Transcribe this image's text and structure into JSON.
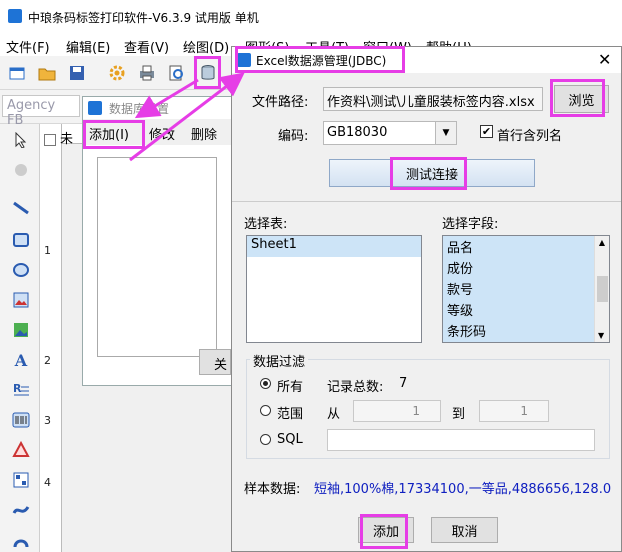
{
  "app": {
    "title": "中琅条码标签打印软件-V6.3.9 试用版 单机",
    "menu": [
      "文件(F)",
      "编辑(E)",
      "查看(V)",
      "绘图(D)",
      "图形(S)",
      "工具(T)",
      "窗口(W)",
      "帮助(H)"
    ],
    "font_placeholder": "Agency FB",
    "untitled_tab": "未"
  },
  "ruler": {
    "marks": [
      "1",
      "2",
      "3",
      "4"
    ]
  },
  "db_window": {
    "title": "数据库设置",
    "tabs": [
      "添加(I)",
      "修改",
      "删除"
    ],
    "close_label": "关"
  },
  "dialog": {
    "title": "Excel数据源管理(JDBC)",
    "file_path_label": "文件路径:",
    "file_path_value": "作资料\\测试\\儿童服装标签内容.xlsx",
    "browse_label": "浏览",
    "encoding_label": "编码:",
    "encoding_value": "GB18030",
    "first_row_label": "首行含列名",
    "first_row_checked": true,
    "test_connection_label": "测试连接",
    "select_table_label": "选择表:",
    "tables": [
      "Sheet1"
    ],
    "select_field_label": "选择字段:",
    "fields": [
      "品名",
      "成份",
      "款号",
      "等级",
      "条形码"
    ],
    "filter": {
      "group_label": "数据过滤",
      "all_label": "所有",
      "record_count_label": "记录总数:",
      "record_count": "7",
      "range_label": "范围",
      "from_label": "从",
      "from_value": "1",
      "to_label": "到",
      "to_value": "1",
      "sql_label": "SQL",
      "selected": "all"
    },
    "sample_label": "样本数据:",
    "sample_value": "短袖,100%棉,17334100,一等品,4886656,128.0",
    "add_label": "添加",
    "cancel_label": "取消"
  },
  "colors": {
    "accent": "#1e73d6",
    "highlight": "#e63de6",
    "sample_text": "#1020c0"
  }
}
